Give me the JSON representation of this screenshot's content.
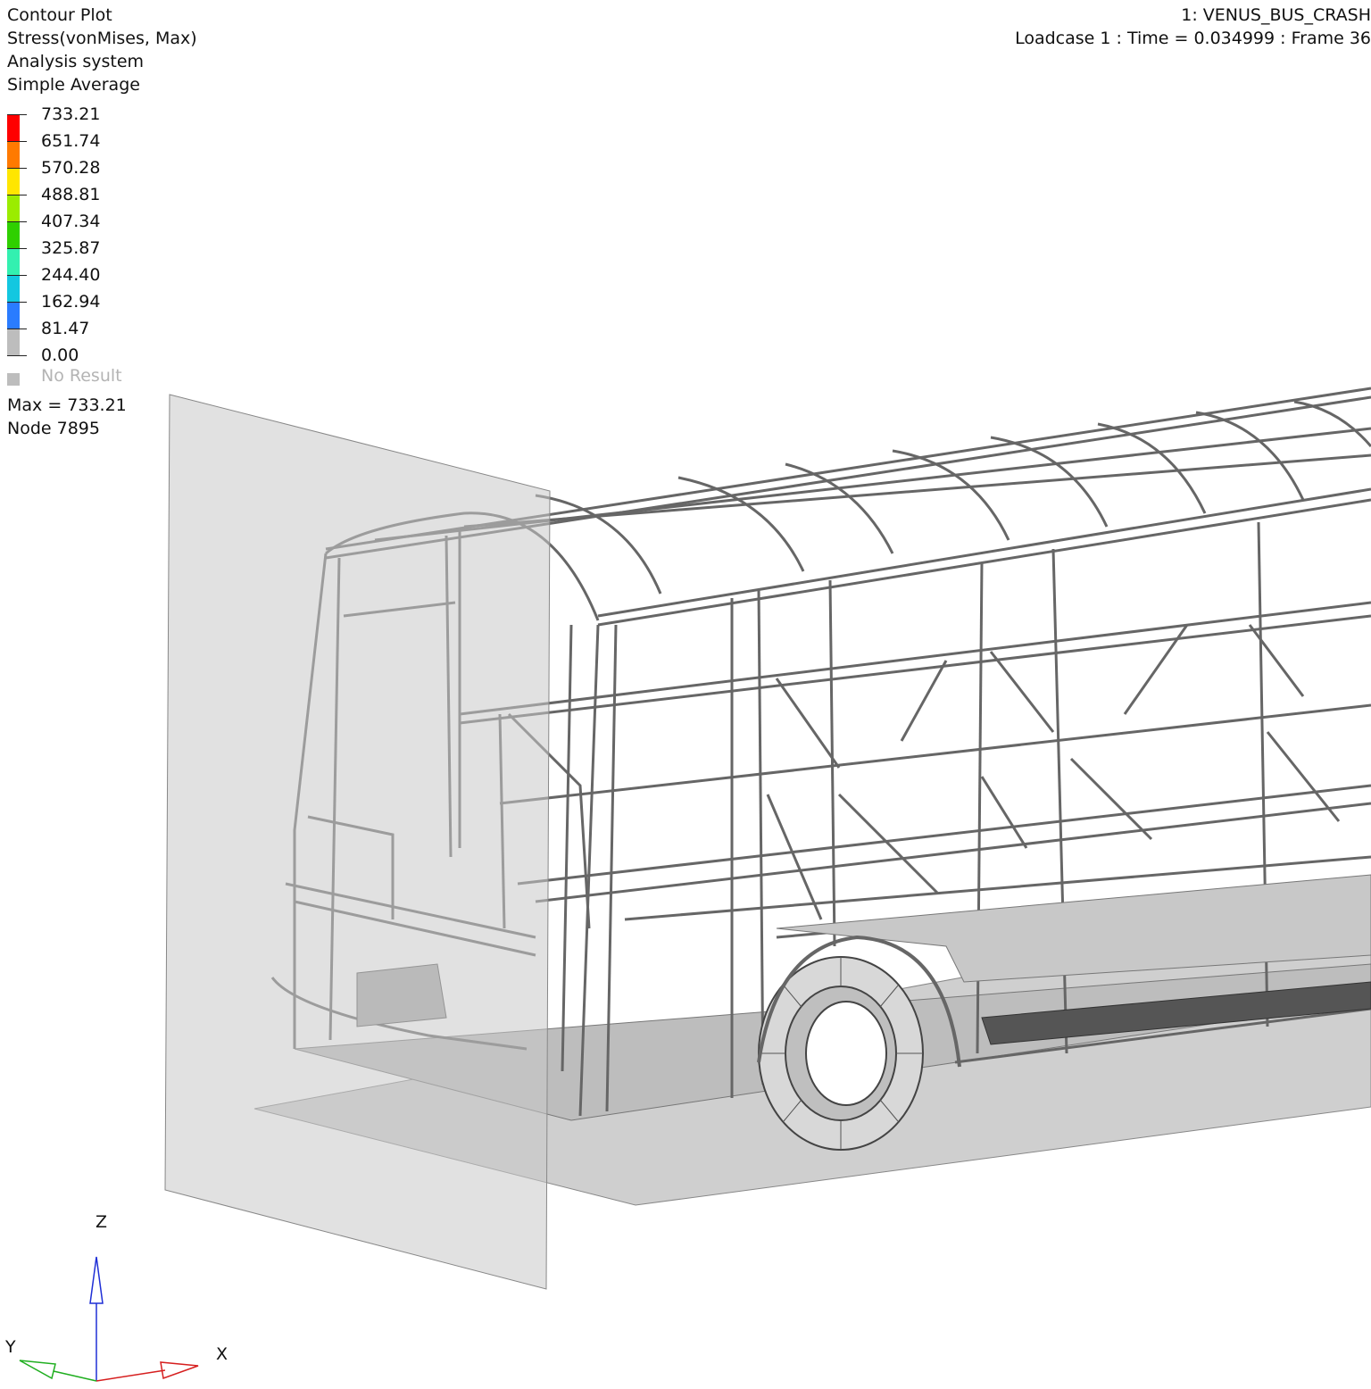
{
  "plot_info": {
    "title": "Contour Plot",
    "result_type": "Stress(vonMises, Max)",
    "system": "Analysis system",
    "averaging": "Simple Average"
  },
  "legend": {
    "labels": [
      "733.21",
      "651.74",
      "570.28",
      "488.81",
      "407.34",
      "325.87",
      "244.40",
      "162.94",
      "81.47",
      "0.00"
    ],
    "colors": [
      "#ff0000",
      "#ff7a00",
      "#ffe600",
      "#9bec00",
      "#2fd000",
      "#33f0b0",
      "#13c7e0",
      "#2a7cff",
      "#bdbdbd"
    ],
    "no_result_label": "No Result"
  },
  "max_info": {
    "max_text": "Max = 733.21",
    "node_text": "Node 7895"
  },
  "model": {
    "name": "1: VENUS_BUS_CRASH",
    "loadcase_text": "Loadcase 1 : Time = 0.034999 : Frame 36"
  },
  "triad": {
    "z_label": "Z",
    "y_label": "Y",
    "x_label": "X",
    "z_color": "#1f2fd6",
    "y_color": "#1fae1f",
    "x_color": "#d61f1f"
  }
}
